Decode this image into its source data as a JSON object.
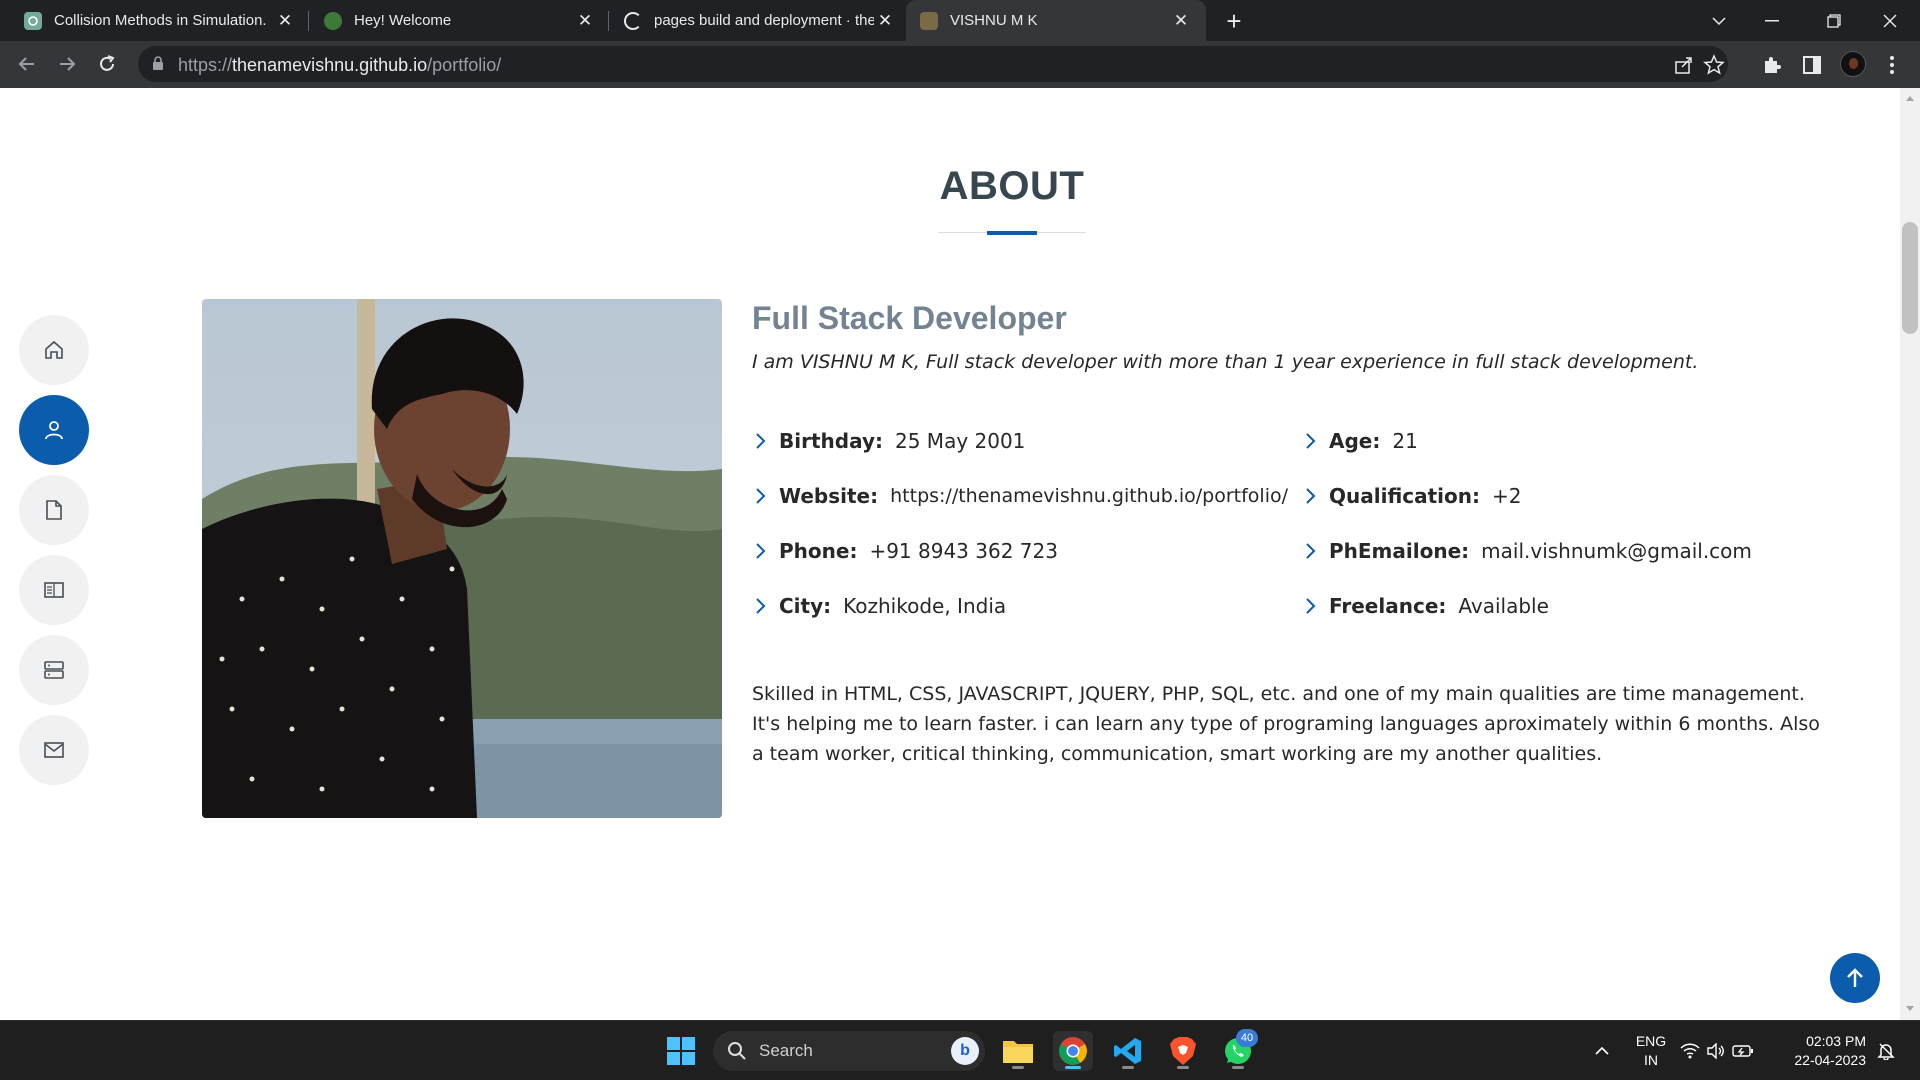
{
  "browser": {
    "tabs": [
      {
        "title": "Collision Methods in Simulation.",
        "favicon": "openai-icon",
        "active": false
      },
      {
        "title": "Hey! Welcome",
        "favicon": "site-icon",
        "active": false
      },
      {
        "title": "pages build and deployment · thenamevishnu",
        "favicon": "github-icon",
        "active": false
      },
      {
        "title": "VISHNU M K",
        "favicon": "portfolio-icon",
        "active": true
      }
    ],
    "url_scheme": "https://",
    "url_host": "thenamevishnu.github.io",
    "url_path": "/portfolio/"
  },
  "section": {
    "title": "ABOUT"
  },
  "about": {
    "role": "Full Stack Developer",
    "intro": "I am VISHNU M K, Full stack developer with more than 1 year experience in full stack development.",
    "details": [
      {
        "label": "Birthday:",
        "value": "25 May 2001"
      },
      {
        "label": "Age:",
        "value": "21"
      },
      {
        "label": "Website:",
        "value": "https://thenamevishnu.github.io/portfolio/"
      },
      {
        "label": "Qualification:",
        "value": "+2"
      },
      {
        "label": "Phone:",
        "value": "+91 8943 362 723"
      },
      {
        "label": "PhEmailone:",
        "value": "mail.vishnumk@gmail.com"
      },
      {
        "label": "City:",
        "value": "Kozhikode, India"
      },
      {
        "label": "Freelance:",
        "value": "Available"
      }
    ],
    "description": "Skilled in HTML, CSS, JAVASCRIPT, JQUERY, PHP, SQL, etc. and one of my main qualities are time management. It's helping me to learn faster. i can learn any type of programing languages aproximately within 6 months. Also a team worker, critical thinking, communication, smart working are my another qualities."
  },
  "sidenav": [
    {
      "icon": "home-icon",
      "active": false
    },
    {
      "icon": "person-icon",
      "active": true
    },
    {
      "icon": "file-icon",
      "active": false
    },
    {
      "icon": "book-icon",
      "active": false
    },
    {
      "icon": "server-icon",
      "active": false
    },
    {
      "icon": "envelope-icon",
      "active": false
    }
  ],
  "taskbar": {
    "search_label": "Search",
    "whatsapp_badge": "40",
    "lang_line1": "ENG",
    "lang_line2": "IN",
    "time": "02:03 PM",
    "date": "22-04-2023"
  },
  "colors": {
    "accent": "#0b5cad",
    "heading": "#37474f",
    "role": "#728394"
  }
}
